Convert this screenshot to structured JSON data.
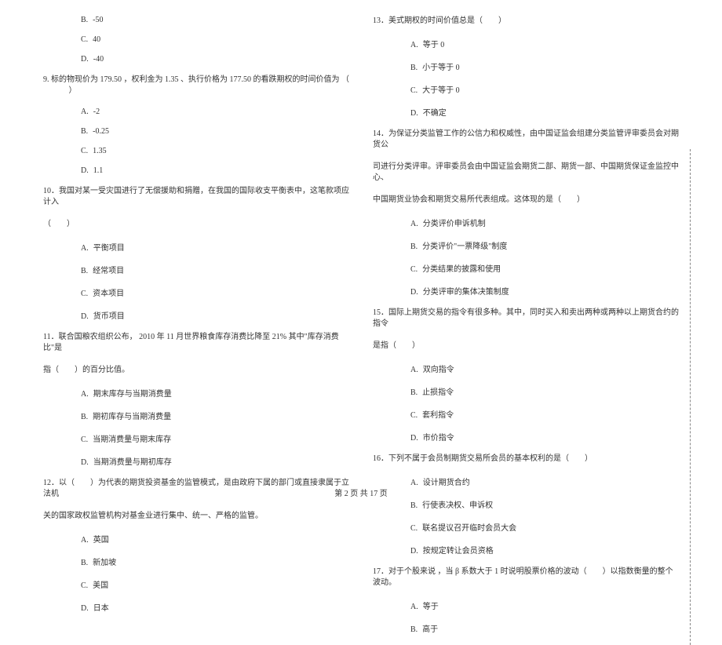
{
  "left": {
    "pre_options": [
      {
        "letter": "B.",
        "text": "-50"
      },
      {
        "letter": "C.",
        "text": "40"
      },
      {
        "letter": "D.",
        "text": "-40"
      }
    ],
    "q9": {
      "stem_parts": [
        "9. 标的物现价为",
        "179.50",
        "，权利金为",
        "1.35",
        "、执行价格为",
        "177.50",
        "的看跌期权的时间价值为",
        "（",
        "）"
      ],
      "options": [
        {
          "letter": "A.",
          "text": "-2"
        },
        {
          "letter": "B.",
          "text": "-0.25"
        },
        {
          "letter": "C.",
          "text": "1.35"
        },
        {
          "letter": "D.",
          "text": "1.1"
        }
      ]
    },
    "q10": {
      "stem1": "10．我国对某一受灾国进行了无偿援助和捐赠，在我国的国际收支平衡表中，这笔款项应计入",
      "stem2": "（　　）",
      "options": [
        {
          "letter": "A.",
          "text": "平衡项目"
        },
        {
          "letter": "B.",
          "text": "经常项目"
        },
        {
          "letter": "C.",
          "text": "资本项目"
        },
        {
          "letter": "D.",
          "text": "货币项目"
        }
      ]
    },
    "q11": {
      "stem1_parts": [
        "11．联合国粮农组织公布，",
        "2010 年 11 月世界粮食库存消费比降至",
        "21%",
        " 其中\"库存消费比\"是"
      ],
      "stem2": "指（　　）的百分比值。",
      "options": [
        {
          "letter": "A.",
          "text": "期末库存与当期消费量"
        },
        {
          "letter": "B.",
          "text": "期初库存与当期消费量"
        },
        {
          "letter": "C.",
          "text": "当期消费量与期末库存"
        },
        {
          "letter": "D.",
          "text": "当期消费量与期初库存"
        }
      ]
    },
    "q12": {
      "stem1": "12．以（　　）为代表的期货投资基金的监管模式，是由政府下属的部门或直接隶属于立法机",
      "stem2": "关的国家政权监管机构对基金业进行集中、统一、严格的监管。",
      "options": [
        {
          "letter": "A.",
          "text": "英国"
        },
        {
          "letter": "B.",
          "text": "新加坡"
        },
        {
          "letter": "C.",
          "text": "美国"
        },
        {
          "letter": "D.",
          "text": "日本"
        }
      ]
    }
  },
  "right": {
    "q13": {
      "stem": "13．美式期权的时间价值总是（　　）",
      "options": [
        {
          "letter": "A.",
          "text": "等于 0"
        },
        {
          "letter": "B.",
          "text": "小于等于 0"
        },
        {
          "letter": "C.",
          "text": "大于等于 0"
        },
        {
          "letter": "D.",
          "text": "不确定"
        }
      ]
    },
    "q14": {
      "stem1": "14．为保证分类监管工作的公信力和权威性，由中国证监会组建分类监管评审委员会对期货公",
      "stem2": "司进行分类评审。评审委员会由中国证监会期货二部、期货一部、中国期货保证金监控中心、",
      "stem3": "中国期货业协会和期货交易所代表组成。这体现的是（　　）",
      "options": [
        {
          "letter": "A.",
          "text": "分类评价申诉机制"
        },
        {
          "letter": "B.",
          "text": "分类评价\"一票降级\"制度"
        },
        {
          "letter": "C.",
          "text": "分类结果的披露和使用"
        },
        {
          "letter": "D.",
          "text": "分类评审的集体决策制度"
        }
      ]
    },
    "q15": {
      "stem1": "15．国际上期货交易的指令有很多种。其中，同时买入和卖出两种或两种以上期货合约的指令",
      "stem2": "是指（　　）",
      "options": [
        {
          "letter": "A.",
          "text": "双向指令"
        },
        {
          "letter": "B.",
          "text": "止损指令"
        },
        {
          "letter": "C.",
          "text": "套利指令"
        },
        {
          "letter": "D.",
          "text": "市价指令"
        }
      ]
    },
    "q16": {
      "stem": "16．下列不属于会员制期货交易所会员的基本权利的是（　　）",
      "options": [
        {
          "letter": "A.",
          "text": "设计期货合约"
        },
        {
          "letter": "B.",
          "text": "行使表决权、申诉权"
        },
        {
          "letter": "C.",
          "text": "联名提议召开临时会员大会"
        },
        {
          "letter": "D.",
          "text": "按规定转让会员资格"
        }
      ]
    },
    "q17": {
      "stem": "17．对于个股来说 ，当 β 系数大于 1 时说明股票价格的波动（　　）以指数衡量的整个波动。",
      "options": [
        {
          "letter": "A.",
          "text": "等于"
        },
        {
          "letter": "B.",
          "text": "高于"
        }
      ]
    }
  },
  "footer": "第 2 页 共 17 页"
}
